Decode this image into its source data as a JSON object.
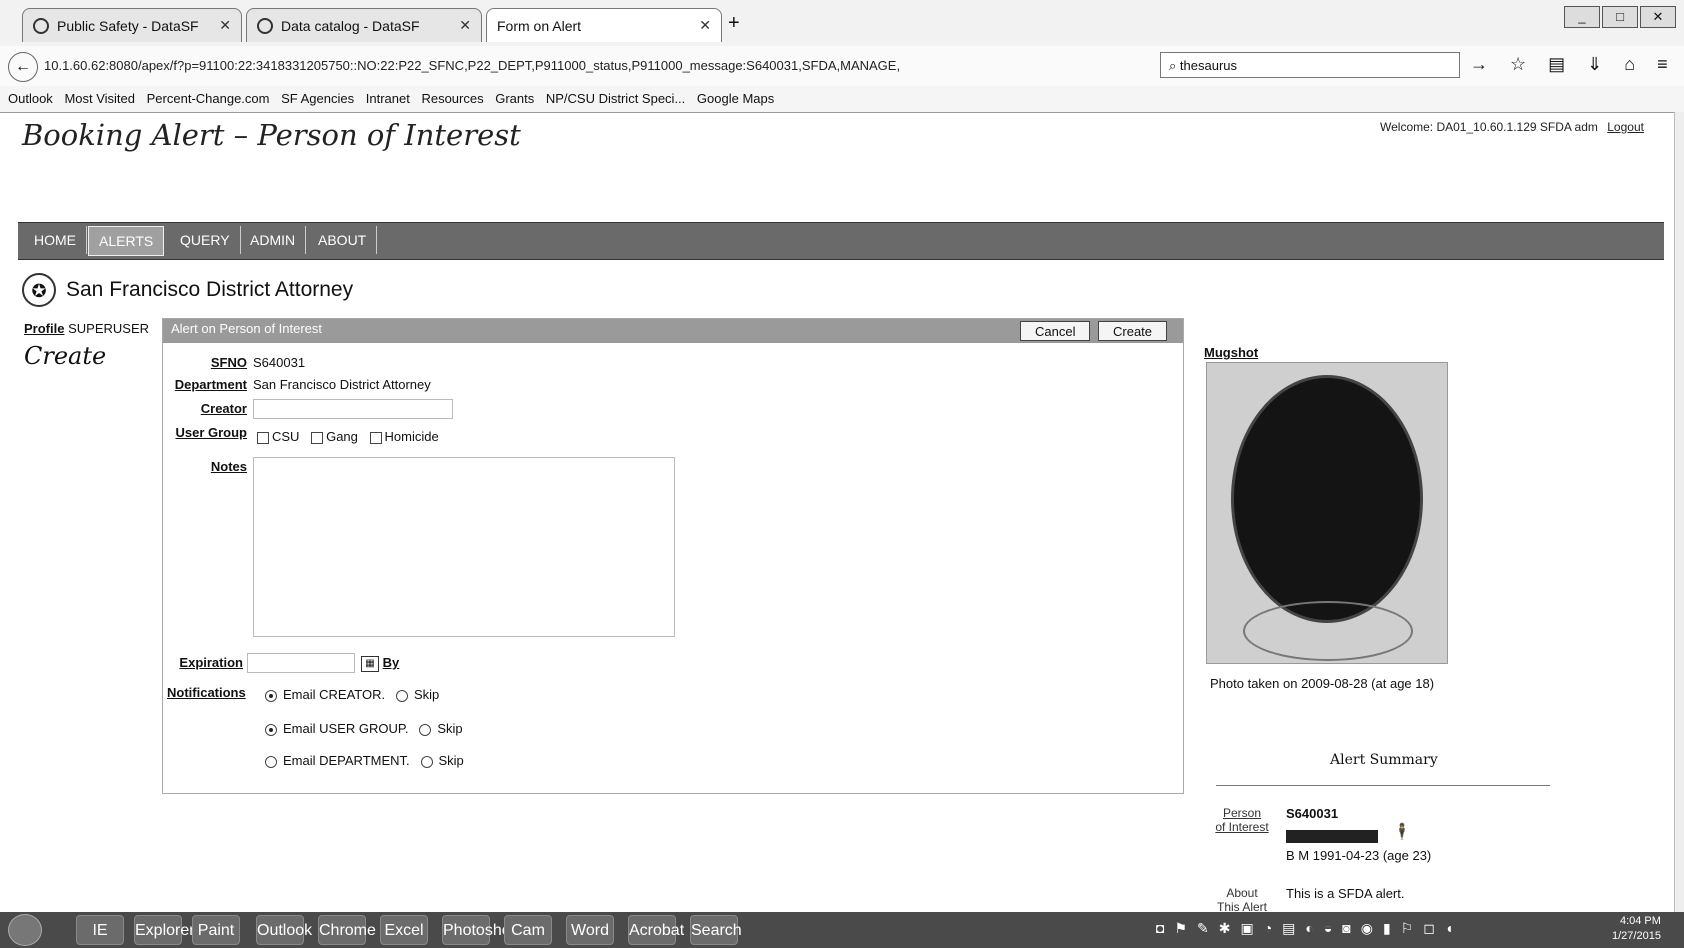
{
  "browser": {
    "tabs": [
      {
        "label": "Public Safety - DataSF",
        "active": false
      },
      {
        "label": "Data catalog - DataSF",
        "active": false
      },
      {
        "label": "Form on Alert",
        "active": true
      }
    ],
    "new_tab": "+",
    "url": "10.1.60.62:8080/apex/f?p=91100:22:3418331205750::NO:22:P22_SFNC,P22_DEPT,P911000_status,P911000_message:S640031,SFDA,MANAGE,",
    "search_value": "thesaurus",
    "bookmarks": [
      "Outlook",
      "Most Visited",
      "Percent-Change.com",
      "SF Agencies",
      "Intranet",
      "Resources",
      "Grants",
      "NP/CSU District Speci...",
      "Google Maps"
    ]
  },
  "app": {
    "title": "Booking Alert – Person of Interest",
    "welcome": "Welcome: DA01_10.60.1.129 SFDA adm",
    "logout": "Logout",
    "nav": [
      "HOME",
      "ALERTS",
      "QUERY",
      "ADMIN",
      "ABOUT"
    ],
    "selected_nav": "ALERTS",
    "agency": "San Francisco District Attorney",
    "profile_label": "Profile",
    "profile_value": "SUPERUSER",
    "mode": "Create"
  },
  "form": {
    "region_title": "Alert on Person of Interest",
    "cancel_label": "Cancel",
    "create_label": "Create",
    "sfno_label": "SFNO",
    "sfno_value": "S640031",
    "department_label": "Department",
    "department_value": "San Francisco District Attorney",
    "creator_label": "Creator",
    "creator_value": "",
    "user_group_label": "User Group",
    "user_groups": [
      "CSU",
      "Gang",
      "Homicide"
    ],
    "notes_label": "Notes",
    "notes_value": "",
    "expiration_label": "Expiration",
    "expiration_value": "",
    "by_label": "By",
    "notifications_label": "Notifications",
    "notify_rows": [
      {
        "email": "Email CREATOR.",
        "skip": "Skip"
      },
      {
        "email": "Email USER GROUP.",
        "skip": "Skip"
      },
      {
        "email": "Email DEPARTMENT.",
        "skip": "Skip"
      }
    ]
  },
  "mugshot": {
    "heading": "Mugshot",
    "caption": "Photo taken on 2009-08-28 (at age 18)"
  },
  "summary": {
    "title": "Alert Summary",
    "person_label_1": "Person",
    "person_label_2": "of Interest",
    "person_id": "S640031",
    "person_desc": "B M 1991-04-23 (age 23)",
    "about_label_1": "About",
    "about_label_2": "This Alert",
    "about_value": "This is a SFDA alert."
  },
  "taskbar": {
    "apps": [
      "IE",
      "Explorer",
      "Paint",
      "Outlook",
      "Chrome",
      "Excel",
      "Photoshop",
      "Cam",
      "Word",
      "Acrobat",
      "Search"
    ],
    "time": "4:04 PM",
    "date": "1/27/2015"
  }
}
